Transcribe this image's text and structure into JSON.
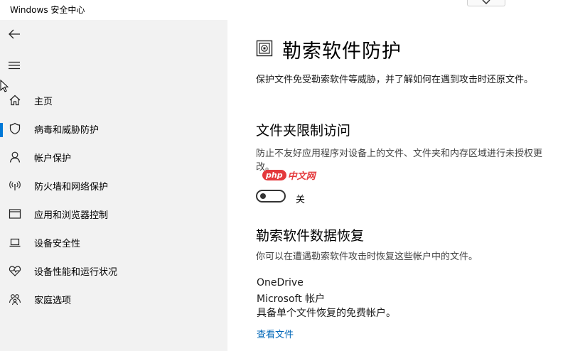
{
  "window": {
    "title": "Windows 安全中心"
  },
  "sidebar": {
    "items": [
      {
        "label": "主页",
        "icon": "home-icon"
      },
      {
        "label": "病毒和威胁防护",
        "icon": "shield-icon",
        "active": true
      },
      {
        "label": "帐户保护",
        "icon": "person-icon"
      },
      {
        "label": "防火墙和网络保护",
        "icon": "wifi-antenna-icon"
      },
      {
        "label": "应用和浏览器控制",
        "icon": "browser-window-icon"
      },
      {
        "label": "设备安全性",
        "icon": "laptop-icon"
      },
      {
        "label": "设备性能和运行状况",
        "icon": "heart-pulse-icon"
      },
      {
        "label": "家庭选项",
        "icon": "family-icon"
      }
    ]
  },
  "main": {
    "title": "勒索软件防护",
    "description": "保护文件免受勒索软件等威胁，并了解如何在遇到攻击时还原文件。",
    "controlled_folder": {
      "heading": "文件夹限制访问",
      "text_line1": "防止不友好应用程序对设备上的文件、文件夹和内存区域进行未授权更",
      "text_line2": "改。",
      "toggle_state": "关",
      "toggle_on": false
    },
    "recovery": {
      "heading": "勒索软件数据恢复",
      "text": "你可以在遭遇勒索软件攻击时恢复这些帐户中的文件。",
      "provider": "OneDrive",
      "account_type": "Microsoft 帐户",
      "plan": "具备单个文件恢复的免费帐户。",
      "view_files_link": "查看文件"
    }
  },
  "watermark": {
    "php": "php",
    "site": "中文网"
  },
  "colors": {
    "accent": "#0078d7",
    "link": "#0067b8",
    "sidebar_bg": "#f2f2f2",
    "watermark": "#e4393c"
  }
}
